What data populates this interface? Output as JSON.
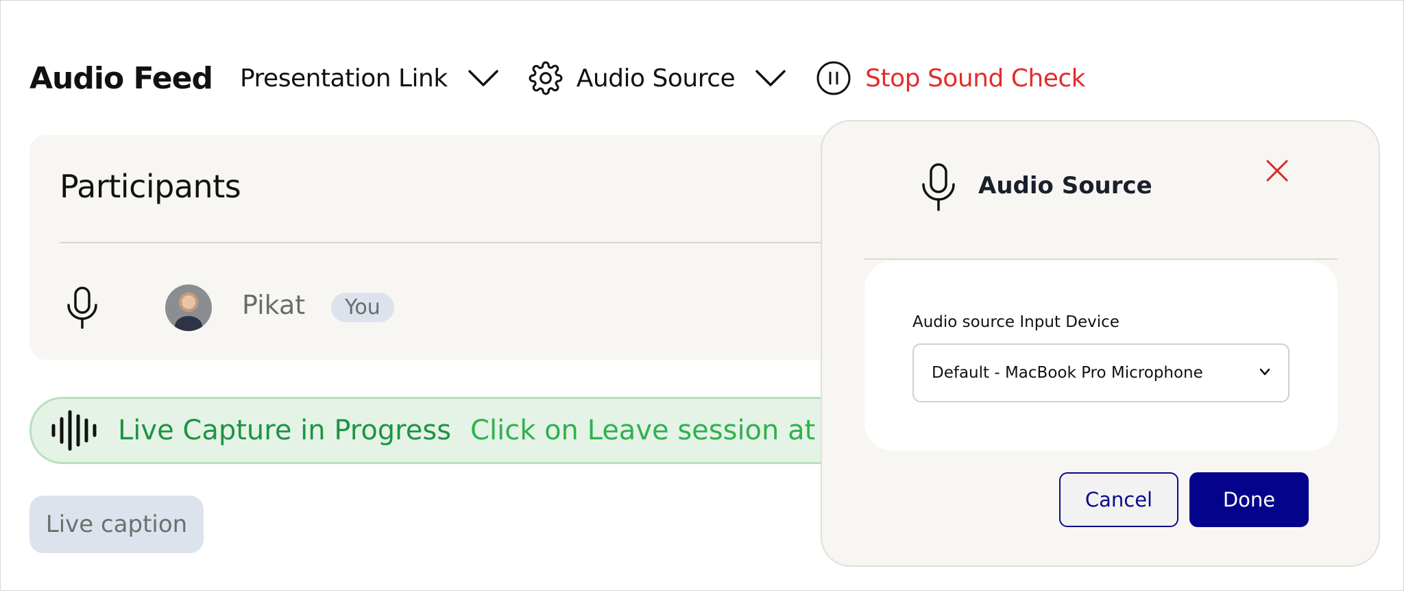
{
  "toolbar": {
    "app_title": "Audio Feed",
    "presentation_link": "Presentation Link",
    "audio_source": "Audio Source",
    "stop_sound_check": "Stop Sound Check"
  },
  "participants": {
    "title": "Participants",
    "items": [
      {
        "name": "Pikat",
        "badge": "You"
      }
    ]
  },
  "live_banner": {
    "title": "Live Capture in Progress",
    "message": "Click on Leave session at the e"
  },
  "live_caption_button": "Live caption",
  "audio_source_dialog": {
    "title": "Audio Source",
    "field_label": "Audio source Input Device",
    "selected_device": "Default - MacBook Pro Microphone",
    "cancel_label": "Cancel",
    "done_label": "Done"
  },
  "colors": {
    "stop_red": "#e52b2b",
    "live_green": "#1d9444",
    "primary_navy": "#03038c",
    "close_red": "#d32a2a"
  }
}
